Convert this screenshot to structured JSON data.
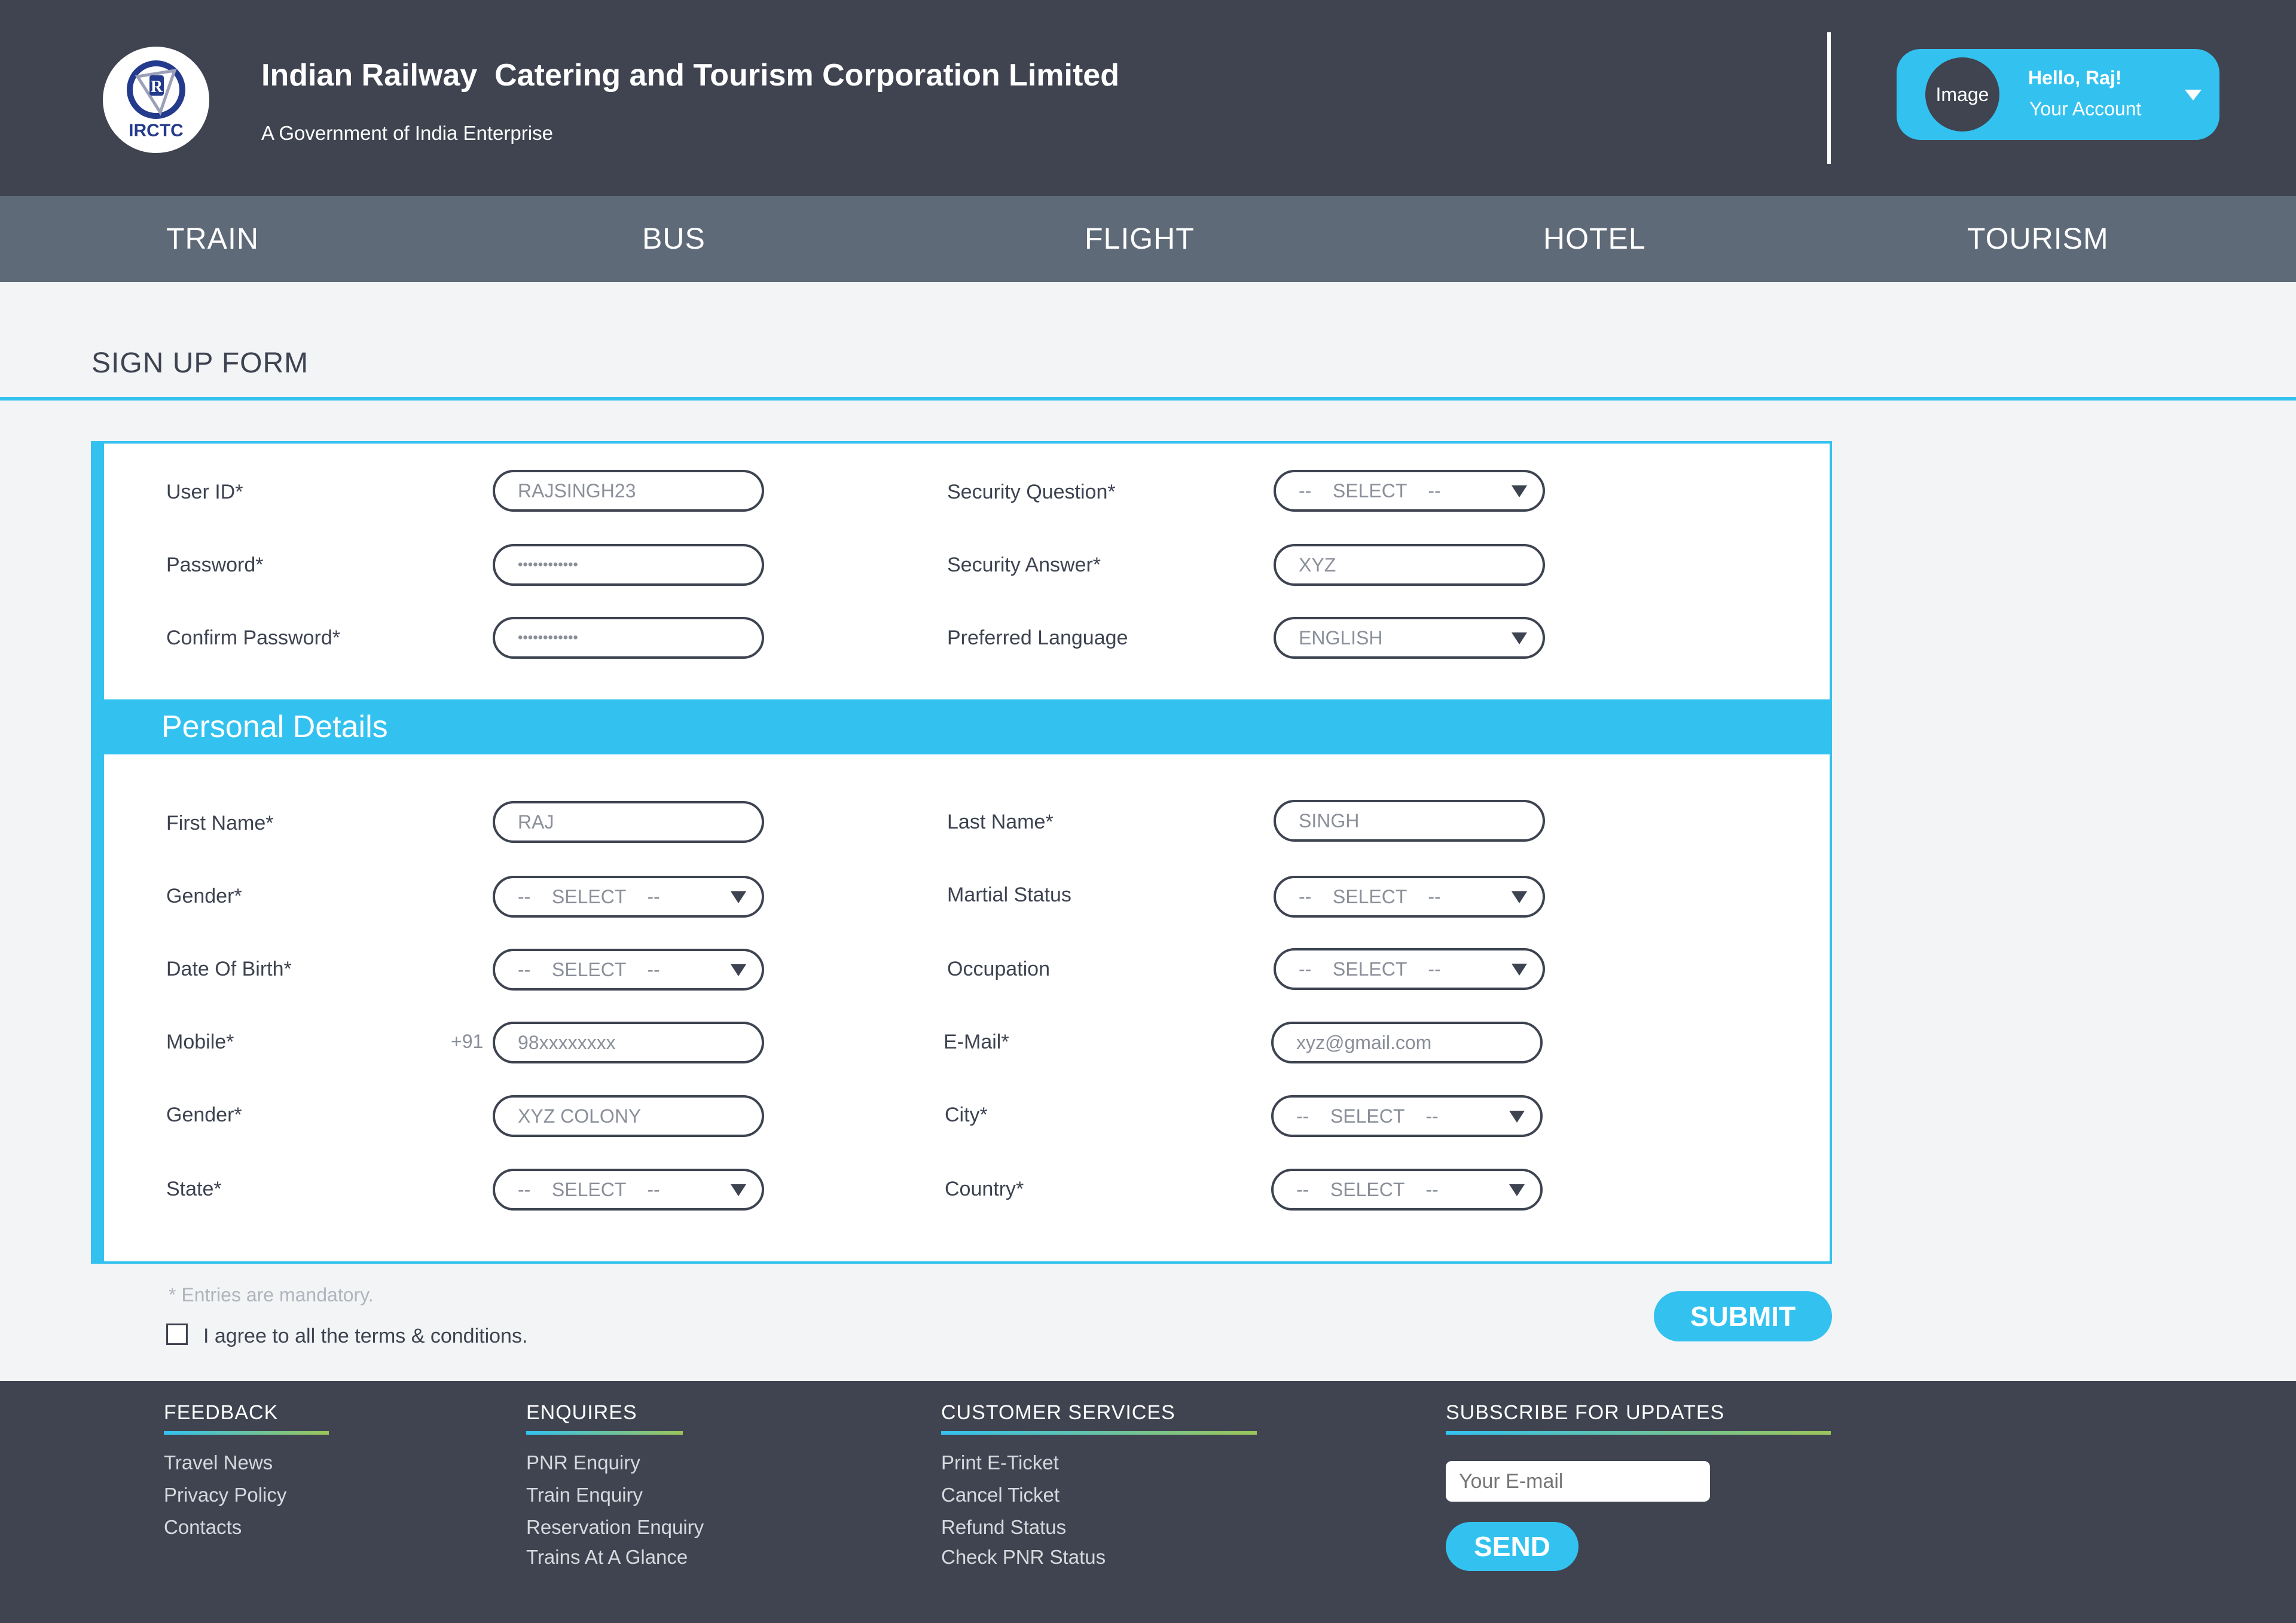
{
  "header": {
    "logo_text": "IRCTC",
    "org_title": "Indian Railway  Catering and Tourism Corporation Limited",
    "org_subtitle": "A Government of India Enterprise",
    "account": {
      "avatar_label": "Image",
      "greeting": "Hello, Raj!",
      "link_label": "Your Account"
    }
  },
  "nav": {
    "items": [
      {
        "label": "TRAIN"
      },
      {
        "label": "BUS"
      },
      {
        "label": "FLIGHT"
      },
      {
        "label": "HOTEL"
      },
      {
        "label": "TOURISM"
      }
    ]
  },
  "page": {
    "title": "SIGN UP FORM"
  },
  "account_form": {
    "user_id": {
      "label": "User ID*",
      "value": "RAJSINGH23"
    },
    "password": {
      "label": "Password*",
      "value": "••••••••••••"
    },
    "confirm_password": {
      "label": "Confirm Password*",
      "value": "••••••••••••"
    },
    "security_question": {
      "label": "Security Question*",
      "value": "--    SELECT    --"
    },
    "security_answer": {
      "label": "Security Answer*",
      "value": "XYZ"
    },
    "preferred_language": {
      "label": "Preferred Language",
      "value": "ENGLISH"
    }
  },
  "personal": {
    "section_title": "Personal Details",
    "first_name": {
      "label": "First Name*",
      "value": "RAJ"
    },
    "last_name": {
      "label": "Last Name*",
      "value": "SINGH"
    },
    "gender": {
      "label": "Gender*",
      "value": "--    SELECT    --"
    },
    "marital_status": {
      "label": "Martial Status",
      "value": "--    SELECT    --"
    },
    "dob": {
      "label": "Date Of Birth*",
      "value": "--    SELECT    --"
    },
    "occupation": {
      "label": "Occupation",
      "value": "--    SELECT    --"
    },
    "mobile": {
      "label": "Mobile*",
      "prefix": "+91",
      "value": "98xxxxxxxx"
    },
    "email": {
      "label": "E-Mail*",
      "value": "xyz@gmail.com"
    },
    "address": {
      "label": "Gender*",
      "value": "XYZ COLONY"
    },
    "city": {
      "label": "City*",
      "value": "--    SELECT    --"
    },
    "state": {
      "label": "State*",
      "value": "--    SELECT    --"
    },
    "country": {
      "label": "Country*",
      "value": "--    SELECT    --"
    }
  },
  "form_footer": {
    "mandatory_note": "* Entries are mandatory.",
    "terms_label": "I agree to all the terms & conditions.",
    "submit_label": "SUBMIT"
  },
  "footer": {
    "feedback": {
      "heading": "FEEDBACK",
      "links": [
        "Travel News",
        "Privacy Policy",
        "Contacts"
      ]
    },
    "enquires": {
      "heading": "ENQUIRES",
      "links": [
        "PNR Enquiry",
        "Train Enquiry",
        "Reservation Enquiry",
        "Trains At A Glance"
      ]
    },
    "customer_services": {
      "heading": "CUSTOMER SERVICES",
      "links": [
        "Print E-Ticket",
        "Cancel Ticket",
        "Refund Status",
        "Check PNR Status"
      ]
    },
    "subscribe": {
      "heading": "SUBSCRIBE FOR UPDATES",
      "email_placeholder": "Your E-mail",
      "send_label": "SEND"
    }
  },
  "colors": {
    "accent": "#33c2f0",
    "header_bg": "#3f4450",
    "nav_bg": "#5f6a78",
    "page_bg": "#f3f4f6"
  }
}
